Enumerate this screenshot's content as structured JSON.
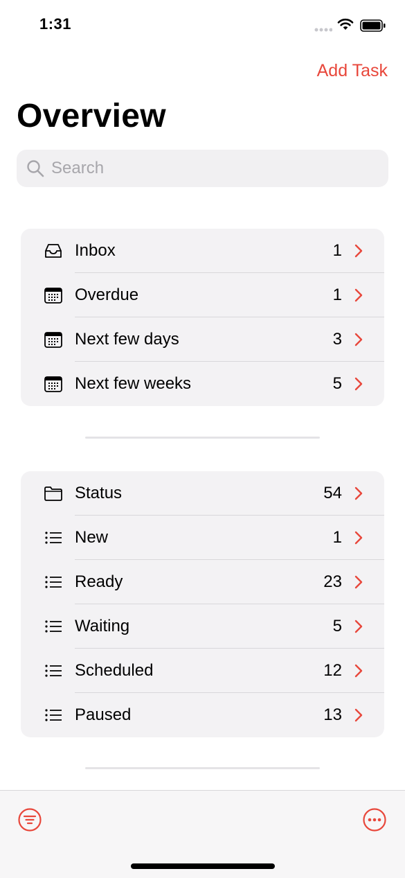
{
  "status_bar": {
    "time": "1:31"
  },
  "header": {
    "add_task_label": "Add Task",
    "title": "Overview"
  },
  "search": {
    "placeholder": "Search"
  },
  "accent_color": "#e8473b",
  "smart_lists": {
    "items": [
      {
        "icon": "tray-icon",
        "label": "Inbox",
        "count": "1"
      },
      {
        "icon": "calendar-icon",
        "label": "Overdue",
        "count": "1"
      },
      {
        "icon": "calendar-icon",
        "label": "Next few days",
        "count": "3"
      },
      {
        "icon": "calendar-icon",
        "label": "Next few weeks",
        "count": "5"
      }
    ]
  },
  "status_lists": {
    "items": [
      {
        "icon": "folder-icon",
        "label": "Status",
        "count": "54"
      },
      {
        "icon": "list-icon",
        "label": "New",
        "count": "1"
      },
      {
        "icon": "list-icon",
        "label": "Ready",
        "count": "23"
      },
      {
        "icon": "list-icon",
        "label": "Waiting",
        "count": "5"
      },
      {
        "icon": "list-icon",
        "label": "Scheduled",
        "count": "12"
      },
      {
        "icon": "list-icon",
        "label": "Paused",
        "count": "13"
      }
    ]
  },
  "toolbar": {
    "left_icon": "filter-icon",
    "right_icon": "more-icon"
  }
}
